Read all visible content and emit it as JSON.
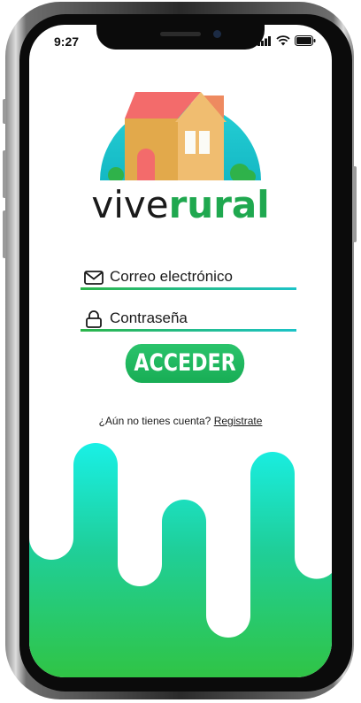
{
  "status_bar": {
    "time": "9:27"
  },
  "logo": {
    "text_part1": "vive",
    "text_part2": "rural"
  },
  "form": {
    "email_label": "Correo electrónico",
    "password_label": "Contraseña",
    "submit_label": "ACCEDER"
  },
  "register": {
    "prompt": "¿Aún no tienes cuenta?",
    "link_label": "Registrate"
  },
  "colors": {
    "brand_green": "#1fa84f",
    "accent_teal": "#1cc3c7",
    "roof_red": "#f36b6b"
  },
  "icons": [
    "mail-icon",
    "lock-icon",
    "signal-icon",
    "wifi-icon",
    "battery-icon"
  ]
}
